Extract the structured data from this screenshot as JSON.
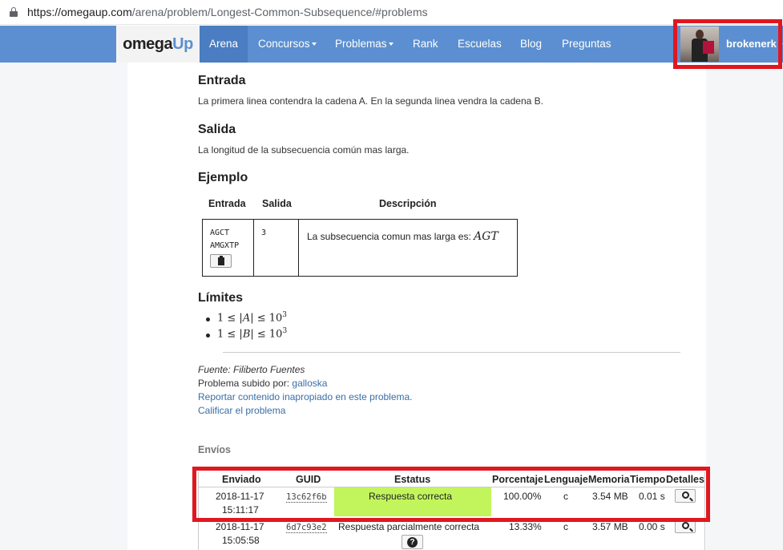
{
  "browser": {
    "url_host": "https://omegaup.com",
    "url_path": "/arena/problem/Longest-Common-Subsequence/#problems"
  },
  "navbar": {
    "logo_part1": "omega",
    "logo_part2": "Up",
    "items": [
      {
        "label": "Arena",
        "active": true
      },
      {
        "label": "Concursos",
        "dropdown": true
      },
      {
        "label": "Problemas",
        "dropdown": true
      },
      {
        "label": "Rank"
      },
      {
        "label": "Escuelas"
      },
      {
        "label": "Blog"
      },
      {
        "label": "Preguntas"
      }
    ],
    "username": "brokenerk"
  },
  "problem": {
    "input_title": "Entrada",
    "input_text": "La primera linea contendra la cadena A. En la segunda linea vendra la cadena B.",
    "output_title": "Salida",
    "output_text": "La longitud de la subsecuencia común mas larga.",
    "example_title": "Ejemplo",
    "example_headers": {
      "input": "Entrada",
      "output": "Salida",
      "description": "Descripción"
    },
    "example": {
      "input_line1": "AGCT",
      "input_line2": "AMGXTP",
      "output": "3",
      "description": "La subsecuencia comun mas larga es:",
      "description_math": "AGT"
    },
    "limits_title": "Límites",
    "limits": [
      {
        "var": "A",
        "exp": "3"
      },
      {
        "var": "B",
        "exp": "3"
      }
    ],
    "source_label": "Fuente: Filiberto Fuentes",
    "uploaded_label": "Problema subido por:",
    "uploaded_user": "galloska",
    "report_link": "Reportar contenido inapropiado en este problema.",
    "rate_link": "Calificar el problema"
  },
  "submissions": {
    "title": "Envíos",
    "headers": [
      "Enviado",
      "GUID",
      "Estatus",
      "Porcentaje",
      "Lenguaje",
      "Memoria",
      "Tiempo",
      "Detalles"
    ],
    "rows": [
      {
        "date": "2018-11-17",
        "time": "15:11:17",
        "guid": "13c62f6b",
        "status": "Respuesta correcta",
        "percent": "100.00%",
        "language": "c",
        "memory": "3.54 MB",
        "runtime": "0.01 s"
      },
      {
        "date": "2018-11-17",
        "time": "15:05:58",
        "guid": "6d7c93e2",
        "status": "Respuesta parcialmente correcta",
        "percent": "13.33%",
        "language": "c",
        "memory": "3.57 MB",
        "runtime": "0.00 s"
      }
    ]
  },
  "colors": {
    "navbar": "#5b8fd1",
    "highlight_box": "#e0171f",
    "status_ok": "#c2f55c",
    "link": "#3a6ea8"
  }
}
